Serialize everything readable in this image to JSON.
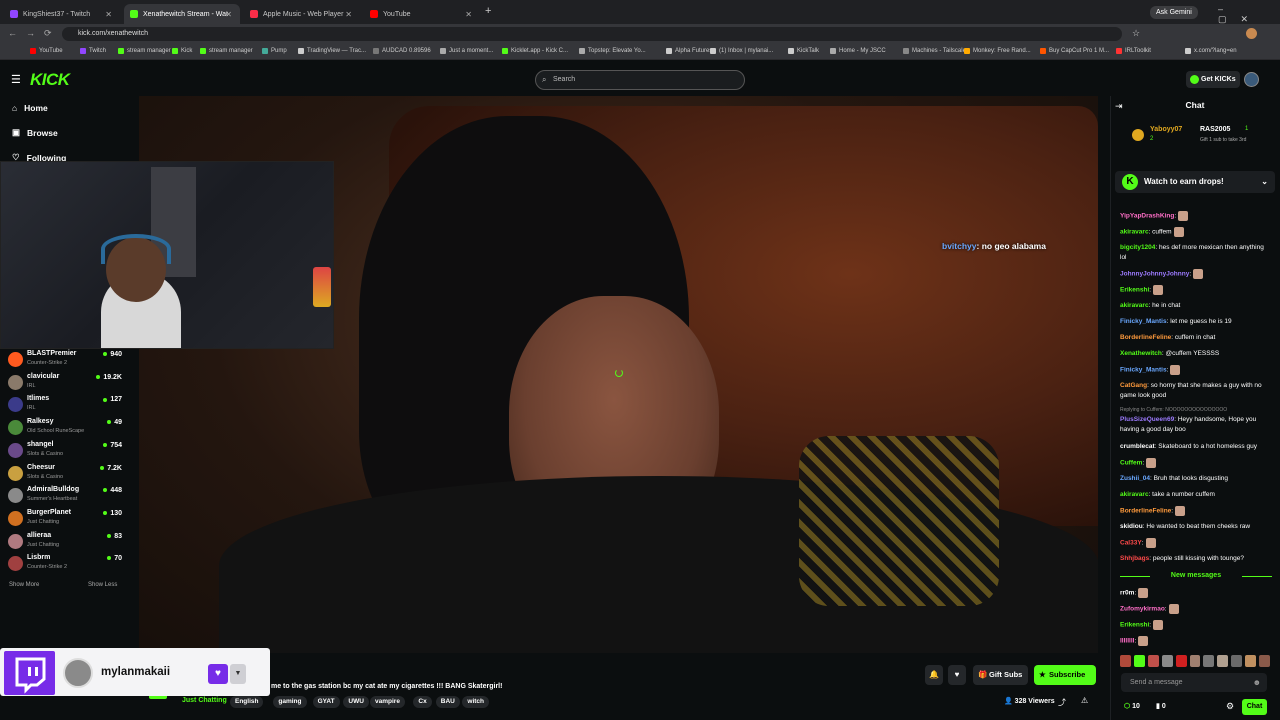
{
  "browser": {
    "tabs": [
      {
        "label": "KingShiest37 - Twitch",
        "color": "#9146ff"
      },
      {
        "label": "Xenathewitch Stream - Wat",
        "color": "#53fc18"
      },
      {
        "label": "Apple Music - Web Player",
        "color": "#fa2d48"
      },
      {
        "label": "YouTube",
        "color": "#ff0000"
      }
    ],
    "url": "kick.com/xenathewitch",
    "ask_gemini": "Ask Gemini",
    "bookmarks": [
      "YouTube",
      "Twitch",
      "stream manager",
      "Kick",
      "stream manager",
      "Pump",
      "TradingView — Trac...",
      "AUDCAD 0.89596",
      "Just a moment...",
      "Kicklet.app - Kick C...",
      "Topstep: Elevate Yo...",
      "Alpha Futures",
      "(1) Inbox | mylanai...",
      "KickTalk",
      "Home - My JSCC",
      "Machines - Tailscale",
      "Monkey: Free Rand...",
      "Buy CapCut Pro 1 M...",
      "IRLToolkit",
      "x.com/?lang=en"
    ]
  },
  "header": {
    "logo": "KICK",
    "search_placeholder": "Search",
    "get_kicks": "Get KICKs"
  },
  "sidebar": {
    "nav": [
      {
        "label": "Home",
        "icon": "home-icon"
      },
      {
        "label": "Browse",
        "icon": "browse-icon"
      },
      {
        "label": "Following",
        "icon": "heart-icon"
      }
    ],
    "channels": [
      {
        "name": "BLASTPremier",
        "category": "Counter-Strike 2",
        "viewers": "940",
        "color": "#ff5a1f"
      },
      {
        "name": "clavicular",
        "category": "IRL",
        "viewers": "19.2K",
        "color": "#8a7a6a"
      },
      {
        "name": "Itlimes",
        "category": "IRL",
        "viewers": "127",
        "color": "#3b3b8a"
      },
      {
        "name": "Ralkesy",
        "category": "Old School RuneScape",
        "viewers": "49",
        "color": "#4a8a3a"
      },
      {
        "name": "shangel",
        "category": "Slots & Casino",
        "viewers": "754",
        "color": "#6a4a8a"
      },
      {
        "name": "Cheesur",
        "category": "Slots & Casino",
        "viewers": "7.2K",
        "color": "#c9a040"
      },
      {
        "name": "AdmiralBulldog",
        "category": "Summer's Heartbeat",
        "viewers": "448",
        "color": "#8a8a8a"
      },
      {
        "name": "BurgerPlanet",
        "category": "Just Chatting",
        "viewers": "130",
        "color": "#d07020"
      },
      {
        "name": "allieraa",
        "category": "Just Chatting",
        "viewers": "83",
        "color": "#b07a80"
      },
      {
        "name": "Lisbrm",
        "category": "Counter-Strike 2",
        "viewers": "70",
        "color": "#a04040"
      }
    ],
    "show_more": "Show More",
    "show_less": "Show Less"
  },
  "video": {
    "overlay_user": "bvitchyy",
    "overlay_text": ": no geo alabama"
  },
  "stream": {
    "title": "me to the gas station bc my cat ate my cigarettes !!! BANG Skatergirl!",
    "category": "Just Chatting",
    "tags": [
      "English",
      "gaming",
      "GYAT",
      "UWU",
      "vampire",
      "Cx",
      "BAU",
      "witch"
    ],
    "viewers": "328 Viewers",
    "gift_subs": "Gift Subs",
    "subscribe": "Subscribe"
  },
  "twitch_overlay": {
    "username": "mylanmakaii"
  },
  "chat": {
    "title": "Chat",
    "top_gifters": [
      {
        "name": "Yaboyy07",
        "count": "2"
      },
      {
        "name": "RAS2005",
        "count": "1"
      }
    ],
    "gifter_note": "Gift 1 sub to take 3rd",
    "drops_banner": "Watch to earn drops!",
    "messages": [
      {
        "user": "YipYapDrashKing",
        "text": ":",
        "color": "#ff6ec7",
        "emote": true
      },
      {
        "user": "akiravarc",
        "text": ": cuffem",
        "color": "#53fc18",
        "emote": true
      },
      {
        "user": "bigcity1204",
        "text": ": hes def more mexican then anything lol",
        "color": "#53fc18"
      },
      {
        "user": "JohnnyJohnnyJohnny",
        "text": ":",
        "color": "#9d7bff",
        "emote": true
      },
      {
        "user": "Erikenshi",
        "text": ":",
        "color": "#53fc18",
        "emote": true
      },
      {
        "user": "akiravarc",
        "text": ": he in chat",
        "color": "#53fc18"
      },
      {
        "user": "Finicky_Mantis",
        "text": ": let me guess he is 19",
        "color": "#6aa8ff"
      },
      {
        "user": "BorderlineFeline",
        "text": ": cuffem in chat",
        "color": "#ff9a3c"
      },
      {
        "user": "Xenathewitch",
        "text": ": @cuffem YESSSS",
        "color": "#53fc18"
      },
      {
        "user": "Finicky_Mantis",
        "text": ":",
        "color": "#6aa8ff",
        "emote": true
      },
      {
        "user": "CatGang",
        "text": ": so horny that she makes a guy with no game look good",
        "color": "#ff9a3c"
      },
      {
        "user": "PlusSizeQueen69",
        "text": ": Heyy handsome, Hope you having a good day boo",
        "color": "#9d7bff"
      },
      {
        "user": "crumblecat",
        "text": ": Skateboard to a hot homeless guy",
        "color": "#ffffff"
      },
      {
        "user": "Cuffem",
        "text": ":",
        "color": "#53fc18",
        "emote": true
      },
      {
        "user": "Zushii_04",
        "text": ": Bruh that looks disgusting",
        "color": "#6aa8ff"
      },
      {
        "user": "akiravarc",
        "text": ": take a number cuffem",
        "color": "#53fc18"
      },
      {
        "user": "BorderlineFeline",
        "text": ":",
        "color": "#ff9a3c",
        "emote": true
      },
      {
        "user": "skidiou",
        "text": ": He wanted to beat them cheeks raw",
        "color": "#ffffff"
      },
      {
        "user": "Cal33Y",
        "text": ":",
        "color": "#ff4a4a",
        "emote": true
      },
      {
        "user": "Shhjbags",
        "text": ": people still kissing with tounge?",
        "color": "#ff4a4a"
      }
    ],
    "reply_note": "Replying to Cuffem: NOOOOOOOOOOOOOOO",
    "new_messages": "New messages",
    "new_msgs": [
      {
        "user": "rr0m",
        "text": ":",
        "color": "#ffffff",
        "emote": true
      },
      {
        "user": "Zufomykirmao",
        "text": ":",
        "color": "#ff6ec7",
        "emote": true
      },
      {
        "user": "Erikenshi",
        "text": ":",
        "color": "#53fc18",
        "emote": true
      },
      {
        "user": "IIIIIIII",
        "text": ":",
        "color": "#ff6ec7",
        "emote": true
      }
    ],
    "input_placeholder": "Send a message",
    "kicks_count": "10",
    "points_count": "0",
    "chat_button": "Chat"
  }
}
